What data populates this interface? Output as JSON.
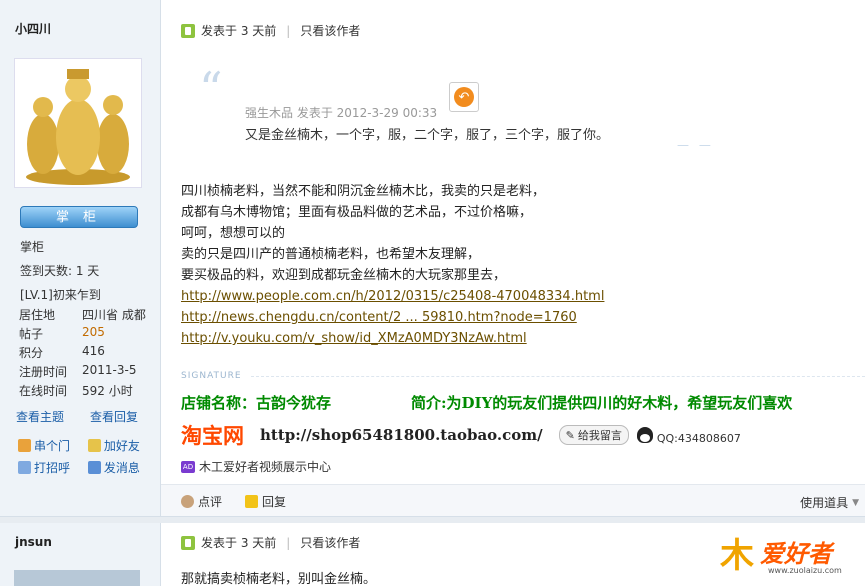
{
  "post1": {
    "author": "小四川",
    "rank_badge": "掌柜",
    "rank_text": "掌柜",
    "signin_days": "签到天数: 1 天",
    "level": "[LV.1]初来乍到",
    "stats": [
      {
        "k": "居住地",
        "v": "四川省 成都",
        "orange": false
      },
      {
        "k": "帖子",
        "v": "205",
        "orange": true
      },
      {
        "k": "积分",
        "v": "416",
        "orange": false
      },
      {
        "k": "注册时间",
        "v": "2011-3-5",
        "orange": false
      },
      {
        "k": "在线时间",
        "v": "592 小时",
        "orange": false
      }
    ],
    "links": {
      "topics": "查看主题",
      "replies": "查看回复"
    },
    "user_actions": {
      "visit": "串个门",
      "add_friend": "加好友",
      "greet": "打招呼",
      "message": "发消息"
    },
    "meta": {
      "posted": "发表于 3 天前",
      "author_only": "只看该作者"
    },
    "quote": {
      "author": "强生木品",
      "time": "发表于 2012-3-29 00:33",
      "text": "又是金丝楠木，一个字，服，二个字，服了，三个字，服了你。"
    },
    "content_lines": [
      "四川桢楠老料，当然不能和阴沉金丝楠木比，我卖的只是老料，",
      "成都有乌木博物馆；里面有极品料做的艺术品，不过价格嘛，",
      "呵呵，想想可以的",
      "卖的只是四川产的普通桢楠老料，也希望木友理解，",
      "要买极品的料，欢迎到成都玩金丝楠木的大玩家那里去，"
    ],
    "content_links": [
      "http://www.people.com.cn/h/2012/0315/c25408-470048334.html",
      "http://news.chengdu.cn/content/2 ... 59810.htm?node=1760",
      "http://v.youku.com/v_show/id_XMzA0MDY3NzAw.html"
    ],
    "signature": {
      "label": "SIGNATURE",
      "shop_name": "店铺名称：古韵今犹存",
      "intro": "简介:为DIY的玩友们提供四川的好木料，希望玩友们喜欢",
      "taobao": "淘宝网",
      "shop_url": "http://shop65481800.taobao.com/",
      "leave_msg": "给我留言",
      "qq": "QQ:434808607"
    },
    "video": "木工爱好者视频展示中心",
    "actions": {
      "rate": "点评",
      "reply": "回复",
      "tools": "使用道具"
    }
  },
  "post2": {
    "author": "jnsun",
    "meta": {
      "posted": "发表于 3 天前",
      "author_only": "只看该作者"
    },
    "text": "那就搞卖桢楠老料，别叫金丝楠。"
  },
  "watermark": {
    "char": "木",
    "text": "爱好者",
    "url": "www.zuolaizu.com"
  }
}
